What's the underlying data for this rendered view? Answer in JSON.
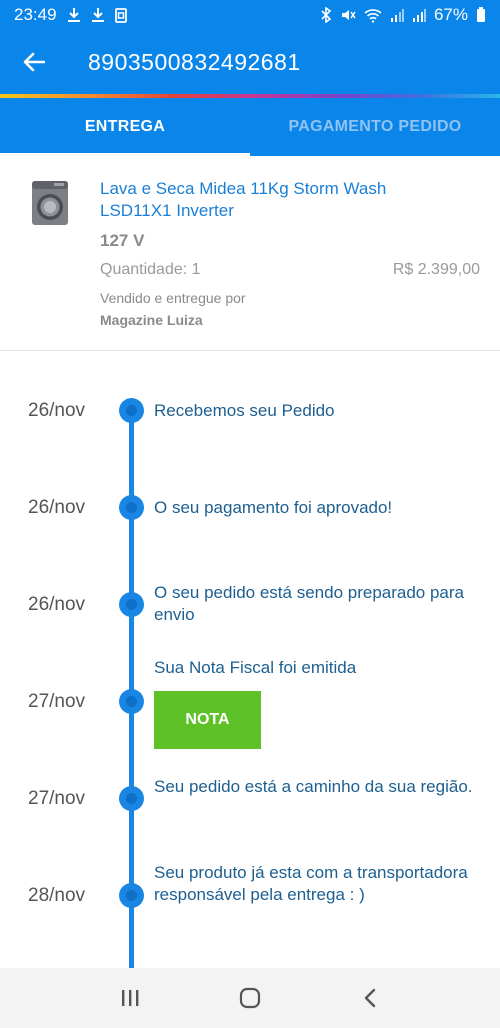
{
  "status_bar": {
    "time": "23:49",
    "battery_percent": "67%",
    "icons": [
      "download-icon",
      "download-icon",
      "clipboard-icon",
      "bluetooth-icon",
      "mute-icon",
      "wifi-icon",
      "signal-icon",
      "signal-icon",
      "battery-icon"
    ]
  },
  "header": {
    "title": "8903500832492681",
    "back_icon": "arrow-left-icon"
  },
  "tabs": [
    {
      "label": "ENTREGA",
      "active": true
    },
    {
      "label": "PAGAMENTO PEDIDO",
      "active": false
    }
  ],
  "product": {
    "name": "Lava e Seca Midea 11Kg Storm Wash LSD11X1 Inverter",
    "voltage": "127 V",
    "quantity": "Quantidade: 1",
    "price": "R$ 2.399,00",
    "seller_label": "Vendido e entregue por",
    "seller": "Magazine Luiza"
  },
  "timeline": {
    "events": [
      {
        "date": "26/nov",
        "text": "Recebemos seu Pedido"
      },
      {
        "date": "26/nov",
        "text": "O seu pagamento foi aprovado!"
      },
      {
        "date": "26/nov",
        "text": "O seu pedido está sendo preparado para envio"
      },
      {
        "date": "27/nov",
        "text": "Sua Nota Fiscal foi emitida",
        "button": "NOTA"
      },
      {
        "date": "27/nov",
        "text": "Seu pedido está a caminho da sua região."
      },
      {
        "date": "28/nov",
        "text": "Seu produto já esta com a transportadora responsável pela entrega : )"
      }
    ]
  },
  "colors": {
    "primary": "#0a85ea",
    "timeline": "#1a86e4",
    "nota_button": "#5ec128",
    "link_text": "#1a7fd6"
  },
  "nav_bar": {
    "icons": [
      "recents-icon",
      "home-icon",
      "back-icon"
    ]
  }
}
